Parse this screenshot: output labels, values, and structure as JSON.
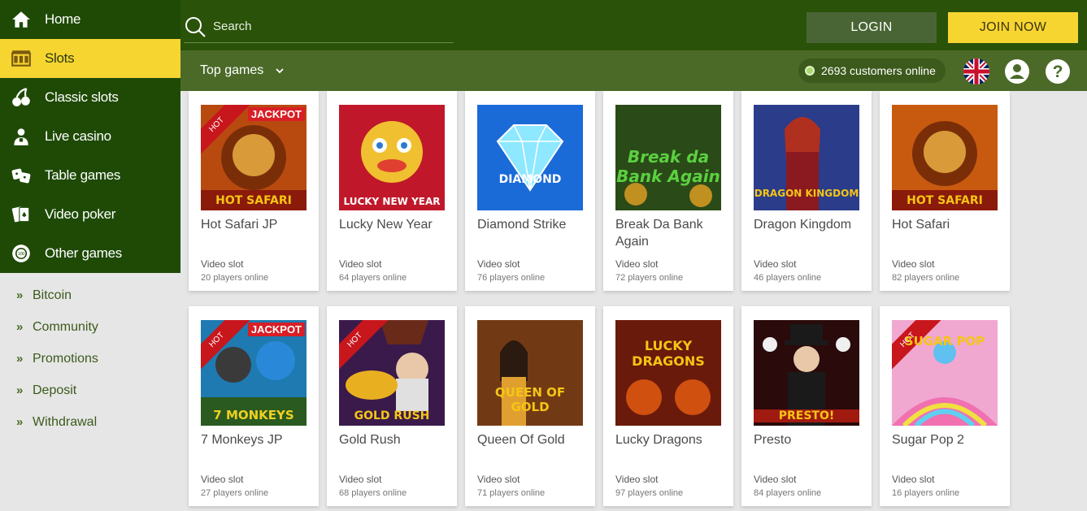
{
  "sidebar": {
    "main": [
      {
        "label": "Home",
        "icon": "home-icon"
      },
      {
        "label": "Slots",
        "icon": "slot-machine-icon",
        "active": true
      },
      {
        "label": "Classic slots",
        "icon": "cherries-icon"
      },
      {
        "label": "Live casino",
        "icon": "dealer-icon"
      },
      {
        "label": "Table games",
        "icon": "dice-icon"
      },
      {
        "label": "Video poker",
        "icon": "cards-icon"
      },
      {
        "label": "Other games",
        "icon": "chip-icon"
      }
    ],
    "sub": [
      {
        "label": "Bitcoin"
      },
      {
        "label": "Community"
      },
      {
        "label": "Promotions"
      },
      {
        "label": "Deposit"
      },
      {
        "label": "Withdrawal"
      }
    ]
  },
  "header": {
    "search_placeholder": "Search",
    "login_label": "LOGIN",
    "join_label": "JOIN NOW"
  },
  "subbar": {
    "filter_label": "Top games",
    "online_text": "2693 customers online"
  },
  "colors": {
    "dark_green": "#1e4a06",
    "header_green": "#2a5209",
    "subbar_green": "#4b6a28",
    "yellow": "#f7d531",
    "jackpot_red": "#d81f26"
  },
  "games": [
    {
      "title": "Hot Safari JP",
      "type": "Video slot",
      "players": "20 players online",
      "hot": true,
      "jackpot": "JACKPOT",
      "art": "HOT SAFARI"
    },
    {
      "title": "Lucky New Year",
      "type": "Video slot",
      "players": "64 players online",
      "art": "LUCKY NEW YEAR"
    },
    {
      "title": "Diamond Strike",
      "type": "Video slot",
      "players": "76 players online",
      "art": "DIAMOND"
    },
    {
      "title": "Break Da Bank Again",
      "type": "Video slot",
      "players": "72 players online",
      "art": "Break da Bank Again"
    },
    {
      "title": "Dragon Kingdom",
      "type": "Video slot",
      "players": "46 players online",
      "art": "DRAGON KINGDOM"
    },
    {
      "title": "Hot Safari",
      "type": "Video slot",
      "players": "82 players online",
      "art": "HOT SAFARI"
    },
    {
      "title": "7 Monkeys JP",
      "type": "Video slot",
      "players": "27 players online",
      "hot": true,
      "jackpot": "JACKPOT",
      "art": "7 MONKEYS"
    },
    {
      "title": "Gold Rush",
      "type": "Video slot",
      "players": "68 players online",
      "hot": true,
      "art": "GOLD RUSH"
    },
    {
      "title": "Queen Of Gold",
      "type": "Video slot",
      "players": "71 players online",
      "art": "QUEEN OF GOLD"
    },
    {
      "title": "Lucky Dragons",
      "type": "Video slot",
      "players": "97 players online",
      "art": "LUCKY DRAGONS"
    },
    {
      "title": "Presto",
      "type": "Video slot",
      "players": "84 players online",
      "art": "PRESTO!"
    },
    {
      "title": "Sugar Pop 2",
      "type": "Video slot",
      "players": "16 players online",
      "hot": true,
      "art": "SUGAR POP"
    }
  ],
  "hot_label": "HOT"
}
